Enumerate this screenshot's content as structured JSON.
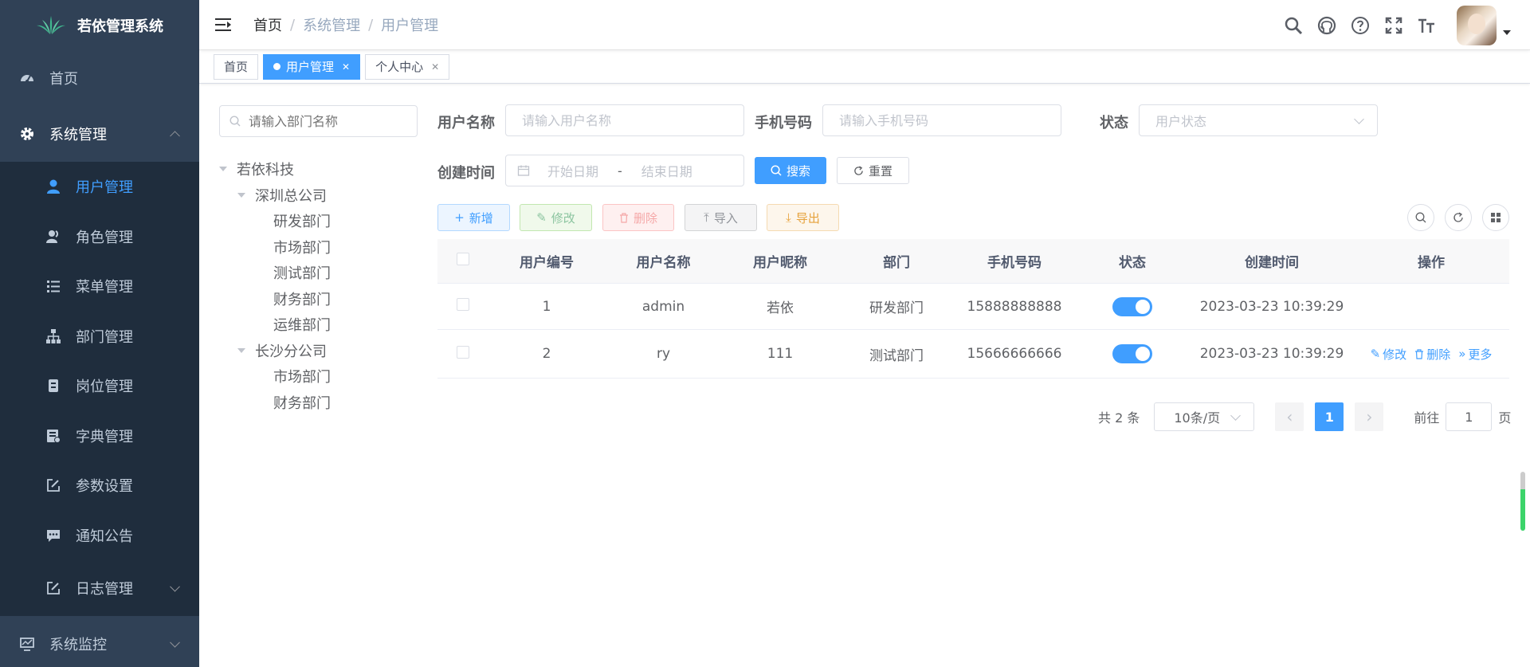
{
  "sidebar": {
    "logo_text": "若依管理系统",
    "items": [
      {
        "label": "首页",
        "icon": "dashboard-icon"
      },
      {
        "label": "系统管理",
        "icon": "gear-icon",
        "expanded": true
      },
      {
        "label": "用户管理",
        "icon": "user-icon",
        "active": true
      },
      {
        "label": "角色管理",
        "icon": "peoples-icon"
      },
      {
        "label": "菜单管理",
        "icon": "tree-table-icon"
      },
      {
        "label": "部门管理",
        "icon": "tree-icon"
      },
      {
        "label": "岗位管理",
        "icon": "post-icon"
      },
      {
        "label": "字典管理",
        "icon": "dict-icon"
      },
      {
        "label": "参数设置",
        "icon": "edit-icon"
      },
      {
        "label": "通知公告",
        "icon": "message-icon"
      },
      {
        "label": "日志管理",
        "icon": "log-icon"
      },
      {
        "label": "系统监控",
        "icon": "monitor-icon"
      }
    ]
  },
  "navbar": {
    "breadcrumb": [
      "首页",
      "系统管理",
      "用户管理"
    ],
    "separator": "/"
  },
  "tags": [
    {
      "label": "首页",
      "active": false
    },
    {
      "label": "用户管理",
      "active": true
    },
    {
      "label": "个人中心",
      "active": false
    }
  ],
  "dept": {
    "search_placeholder": "请输入部门名称",
    "tree": [
      {
        "label": "若依科技",
        "level": 0,
        "expandable": true
      },
      {
        "label": "深圳总公司",
        "level": 1,
        "expandable": true
      },
      {
        "label": "研发部门",
        "level": 2
      },
      {
        "label": "市场部门",
        "level": 2
      },
      {
        "label": "测试部门",
        "level": 2
      },
      {
        "label": "财务部门",
        "level": 2
      },
      {
        "label": "运维部门",
        "level": 2
      },
      {
        "label": "长沙分公司",
        "level": 1,
        "expandable": true
      },
      {
        "label": "市场部门",
        "level": 2
      },
      {
        "label": "财务部门",
        "level": 2
      }
    ]
  },
  "query": {
    "username_label": "用户名称",
    "username_placeholder": "请输入用户名称",
    "phone_label": "手机号码",
    "phone_placeholder": "请输入手机号码",
    "status_label": "状态",
    "status_placeholder": "用户状态",
    "created_label": "创建时间",
    "start_placeholder": "开始日期",
    "range_sep": "-",
    "end_placeholder": "结束日期",
    "search_btn": "搜索",
    "reset_btn": "重置"
  },
  "toolbar": {
    "add": "新增",
    "edit": "修改",
    "delete": "删除",
    "import": "导入",
    "export": "导出"
  },
  "table": {
    "columns": [
      "用户编号",
      "用户名称",
      "用户昵称",
      "部门",
      "手机号码",
      "状态",
      "创建时间",
      "操作"
    ],
    "rows": [
      {
        "id": "1",
        "username": "admin",
        "nickname": "若依",
        "dept": "研发部门",
        "phone": "15888888888",
        "status": true,
        "created": "2023-03-23 10:39:29",
        "ops": []
      },
      {
        "id": "2",
        "username": "ry",
        "nickname": "111",
        "dept": "测试部门",
        "phone": "15666666666",
        "status": true,
        "created": "2023-03-23 10:39:29",
        "ops": [
          "修改",
          "删除",
          "更多"
        ]
      }
    ]
  },
  "pagination": {
    "total_text": "共 2 条",
    "page_size": "10条/页",
    "current_page": "1",
    "goto_prefix": "前往",
    "goto_value": "1",
    "goto_suffix": "页"
  },
  "colors": {
    "sidebar_bg": "#304156",
    "submenu_bg": "#1f2d3d",
    "primary": "#409eff"
  }
}
